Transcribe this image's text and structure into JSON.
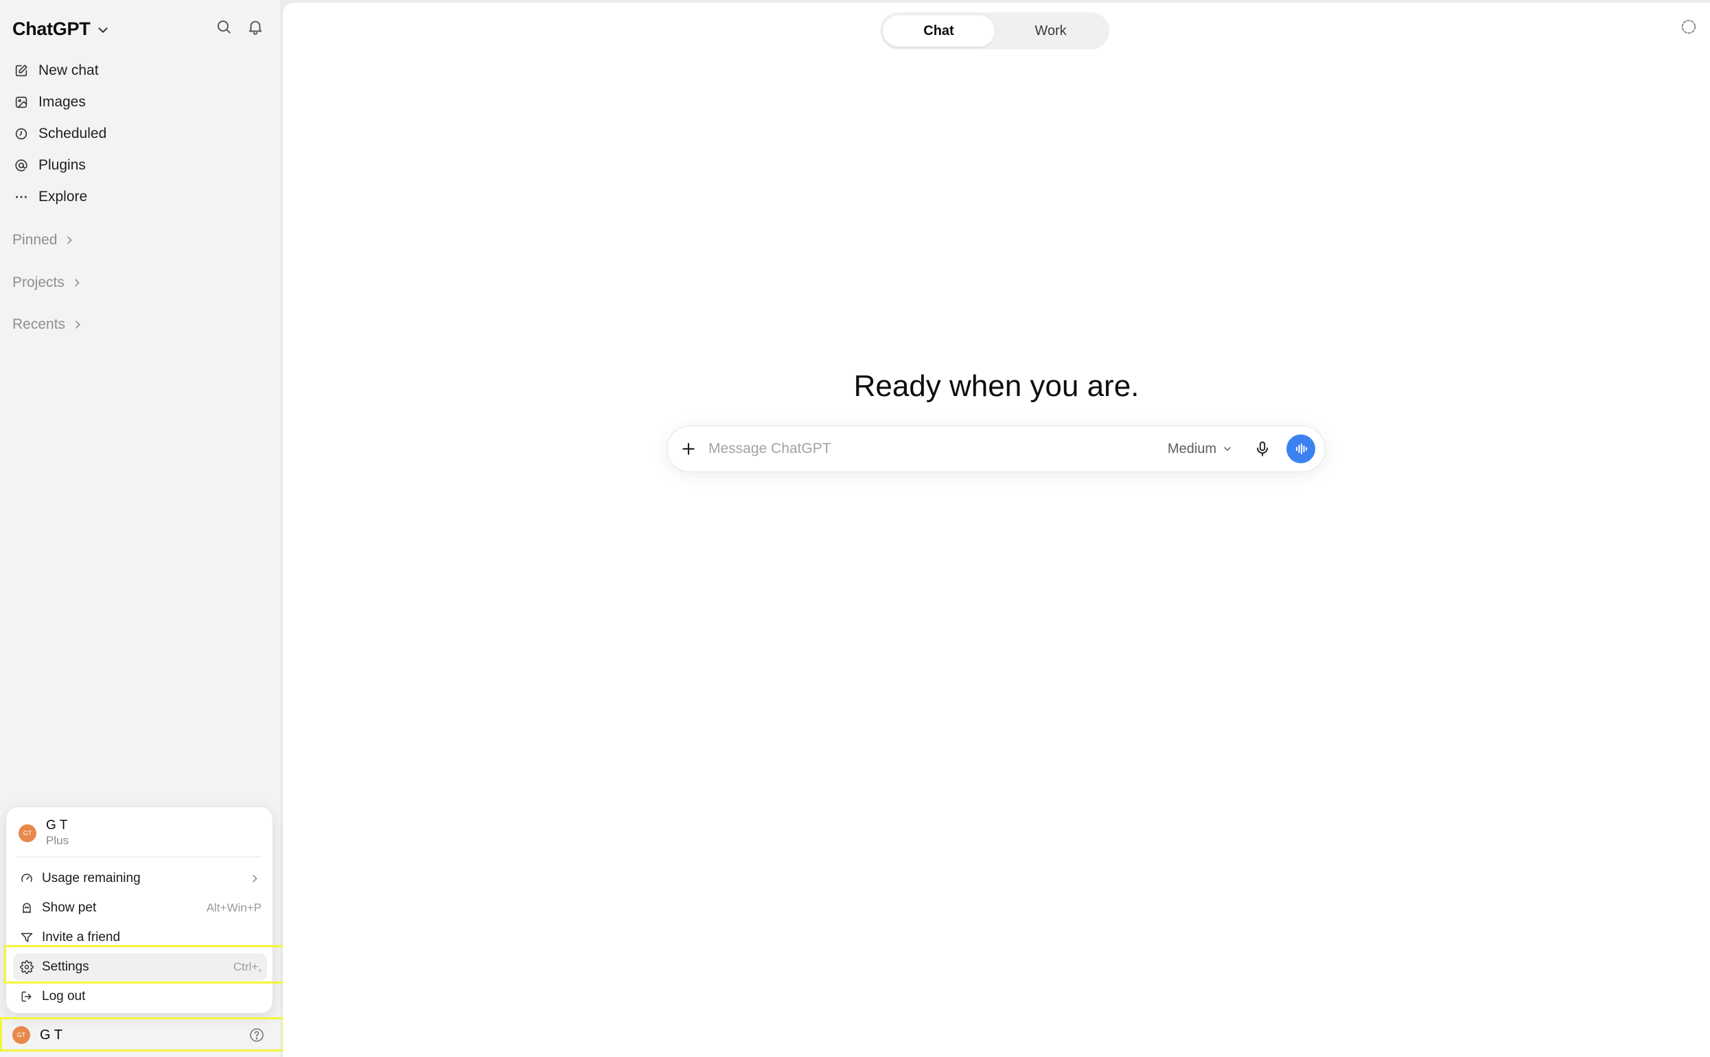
{
  "sidebar": {
    "brand": "ChatGPT",
    "nav": [
      {
        "label": "New chat",
        "icon": "edit-icon"
      },
      {
        "label": "Images",
        "icon": "image-icon"
      },
      {
        "label": "Scheduled",
        "icon": "clock-icon"
      },
      {
        "label": "Plugins",
        "icon": "at-sign-icon"
      },
      {
        "label": "Explore",
        "icon": "more-dots-icon"
      }
    ],
    "sections": {
      "pinned": "Pinned",
      "projects": "Projects",
      "recents": "Recents"
    },
    "account": {
      "avatar_initials": "GT",
      "name": "G T"
    }
  },
  "menu": {
    "user_name": "G T",
    "plan": "Plus",
    "avatar_initials": "GT",
    "items": [
      {
        "label": "Usage remaining",
        "icon": "gauge-icon",
        "shortcut": ""
      },
      {
        "label": "Show pet",
        "icon": "pet-icon",
        "shortcut": "Alt+Win+P"
      },
      {
        "label": "Invite a friend",
        "icon": "send-icon",
        "shortcut": ""
      },
      {
        "label": "Settings",
        "icon": "gear-icon",
        "shortcut": "Ctrl+,"
      },
      {
        "label": "Log out",
        "icon": "logout-icon",
        "shortcut": ""
      }
    ]
  },
  "main": {
    "tabs": [
      {
        "label": "Chat",
        "active": true
      },
      {
        "label": "Work",
        "active": false
      }
    ],
    "hero": "Ready when you are.",
    "composer": {
      "placeholder": "Message ChatGPT",
      "value": "",
      "model": "Medium"
    }
  },
  "colors": {
    "accent_blue": "#3b82f0",
    "avatar_orange": "#e8884c",
    "highlight_yellow": "#f3f53a",
    "sidebar_bg": "#f3f3f3"
  }
}
